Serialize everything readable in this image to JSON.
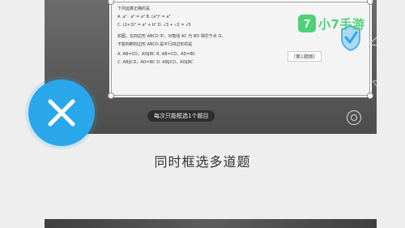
{
  "screen": {
    "caption": "同时框选多道题",
    "hint": "每次只能框选1个题目"
  },
  "worksheet": {
    "lines": [
      "下列运算正确的是",
      "A.  a² · a³ = a⁶                 B.  (a³)² = a⁵",
      "C.  (2+3)² = a² + b²            D.  √3 + √2 = √5",
      "如图，在四边形 ABCD 中，对角线 AC 与 BD 相交于点 O，",
      "不能判断四边形 ABCD 是平行四边形的是",
      "A.  AB=CD，AD∥BC        B.  AB=CD，AD=BC",
      "C.  AB∥CD，AD=BC        D.  AB∥CD，AD∥BC"
    ],
    "side_label": "（第1题图）"
  },
  "close_button": {
    "icon": "close-icon",
    "color": "#2aa7ea"
  },
  "confirm_icon": {
    "icon": "check-icon",
    "color": "#2aa7ea"
  },
  "logo": {
    "badge": "7",
    "text": "小7手游",
    "color": "#4fd17a"
  }
}
